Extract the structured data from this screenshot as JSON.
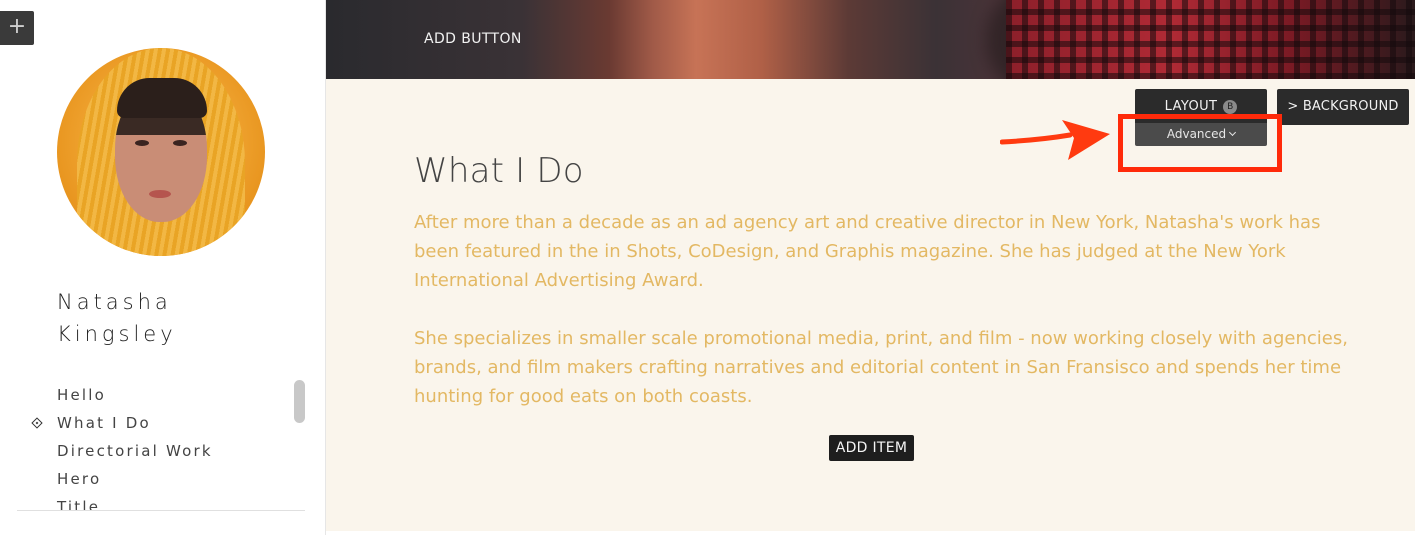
{
  "sidebar": {
    "add_label": "+",
    "name_line1": "Natasha",
    "name_line2": "Kingsley",
    "nav_items": [
      {
        "label": "Hello",
        "active": false
      },
      {
        "label": "What I Do",
        "active": true
      },
      {
        "label": "Directorial Work",
        "active": false
      },
      {
        "label": "Hero",
        "active": false
      },
      {
        "label": "Title",
        "active": false
      }
    ]
  },
  "hero": {
    "add_button_label": "ADD BUTTON"
  },
  "toolbar": {
    "layout_label": "LAYOUT",
    "layout_badge": "B",
    "advanced_label": "Advanced",
    "background_label": "> BACKGROUND",
    "highlight_color": "#ff2a0a"
  },
  "section": {
    "title": "What I Do",
    "paragraph1": "After more than a decade as an ad agency art and creative director in New York, Natasha's work has been featured in the in Shots, CoDesign, and Graphis magazine. She has judged at the New York International Advertising Award.",
    "paragraph2": "She specializes in smaller scale promotional media, print, and film - now working closely with agencies, brands, and film makers crafting narratives and editorial content in San Fransisco and spends her time hunting for good eats on both coasts.",
    "text_color": "#e3b863",
    "add_item_label": "ADD ITEM"
  }
}
